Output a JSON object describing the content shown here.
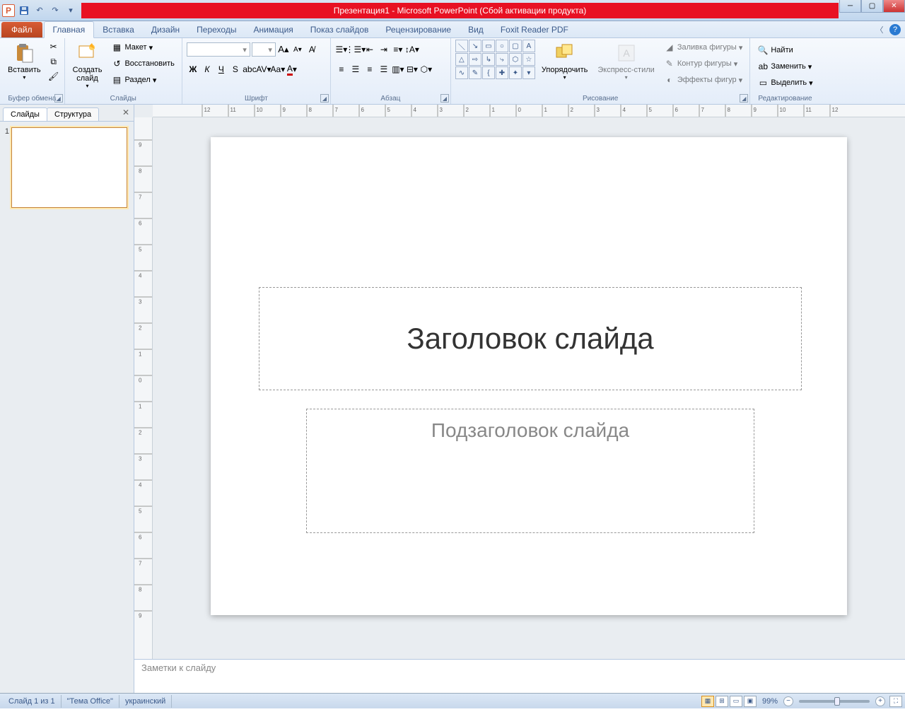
{
  "titlebar": {
    "title": "Презентация1  -  Microsoft PowerPoint (Сбой активации продукта)"
  },
  "tabs": {
    "file": "Файл",
    "items": [
      "Главная",
      "Вставка",
      "Дизайн",
      "Переходы",
      "Анимация",
      "Показ слайдов",
      "Рецензирование",
      "Вид",
      "Foxit Reader PDF"
    ]
  },
  "ribbon": {
    "clipboard": {
      "label": "Буфер обмена",
      "paste": "Вставить"
    },
    "slides": {
      "label": "Слайды",
      "new": "Создать\nслайд",
      "layout": "Макет",
      "reset": "Восстановить",
      "section": "Раздел"
    },
    "font": {
      "label": "Шрифт"
    },
    "paragraph": {
      "label": "Абзац"
    },
    "drawing": {
      "label": "Рисование",
      "arrange": "Упорядочить",
      "quickstyles": "Экспресс-стили",
      "fill": "Заливка фигуры",
      "outline": "Контур фигуры",
      "effects": "Эффекты фигур"
    },
    "editing": {
      "label": "Редактирование",
      "find": "Найти",
      "replace": "Заменить",
      "select": "Выделить"
    }
  },
  "panel": {
    "tab_slides": "Слайды",
    "tab_outline": "Структура",
    "thumb_num": "1"
  },
  "slide": {
    "title": "Заголовок слайда",
    "subtitle": "Подзаголовок слайда"
  },
  "notes": {
    "placeholder": "Заметки к слайду"
  },
  "statusbar": {
    "slide_info": "Слайд 1 из 1",
    "theme": "\"Тема Office\"",
    "language": "украинский",
    "zoom": "99%"
  },
  "ruler_ticks": [
    "12",
    "11",
    "10",
    "9",
    "8",
    "7",
    "6",
    "5",
    "4",
    "3",
    "2",
    "1",
    "0",
    "1",
    "2",
    "3",
    "4",
    "5",
    "6",
    "7",
    "8",
    "9",
    "10",
    "11",
    "12"
  ],
  "vruler_ticks": [
    "9",
    "8",
    "7",
    "6",
    "5",
    "4",
    "3",
    "2",
    "1",
    "0",
    "1",
    "2",
    "3",
    "4",
    "5",
    "6",
    "7",
    "8",
    "9"
  ]
}
